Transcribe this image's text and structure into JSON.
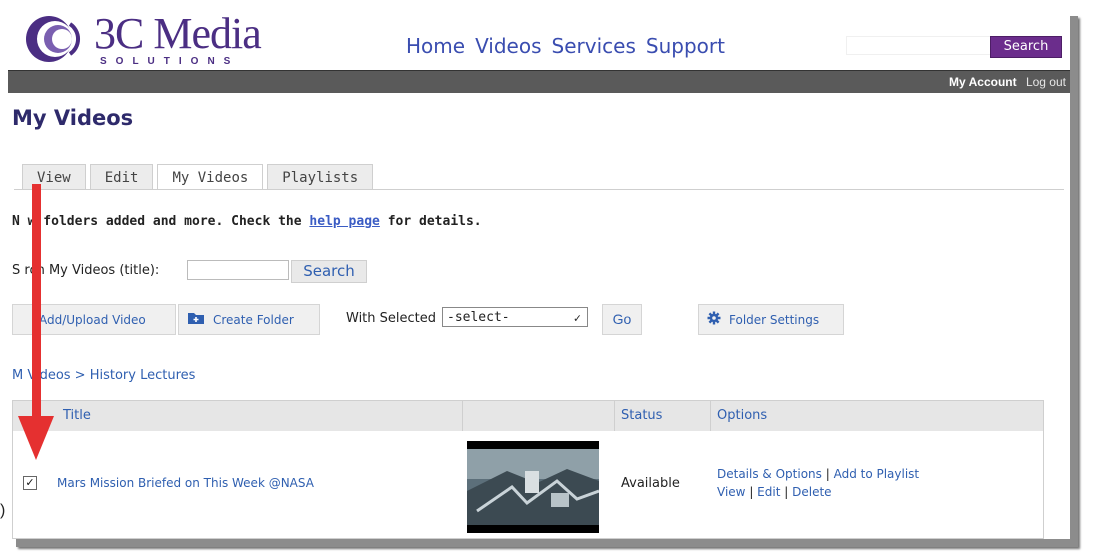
{
  "brand": {
    "name": "3C Media",
    "tagline": "SOLUTIONS",
    "color": "#4b2e83"
  },
  "topnav": [
    {
      "label": "Home"
    },
    {
      "label": "Videos"
    },
    {
      "label": "Services"
    },
    {
      "label": "Support"
    }
  ],
  "site_search": {
    "value": "",
    "button_label": "Search"
  },
  "account": {
    "my_account": "My Account",
    "logout": "Log out"
  },
  "page_title": "My Videos",
  "tabs": [
    {
      "label": "View",
      "active": false
    },
    {
      "label": "Edit",
      "active": false
    },
    {
      "label": "My Videos",
      "active": true
    },
    {
      "label": "Playlists",
      "active": false
    }
  ],
  "notice": {
    "before": "N w folders added and more. Check the ",
    "link": "help page",
    "after": " for details."
  },
  "video_search": {
    "label": "S rch My Videos (title):",
    "value": "",
    "button_label": "Search"
  },
  "toolbar": {
    "add_upload_label": "Add/Upload Video",
    "create_folder_label": "Create Folder",
    "with_selected_label": "With Selected",
    "select_value": "-select-",
    "go_label": "Go",
    "folder_settings_label": "Folder Settings"
  },
  "breadcrumb": {
    "root": "M Videos",
    "sep": " > ",
    "current": "History Lectures"
  },
  "table": {
    "headers": [
      "Title",
      "",
      "Status",
      "Options"
    ],
    "rows": [
      {
        "checked": true,
        "title": "Mars Mission Briefed on This Week @NASA",
        "status": "Available",
        "options_line1": [
          "Details & Options",
          "Add to Playlist"
        ],
        "options_line2": [
          "View",
          "Edit",
          "Delete"
        ]
      }
    ]
  },
  "stray_text": ")",
  "colors": {
    "accent": "#2f5fb0",
    "annotation_arrow": "#e53030",
    "dark_bar": "#5a5a5a",
    "search_button": "#6b2d8c"
  }
}
